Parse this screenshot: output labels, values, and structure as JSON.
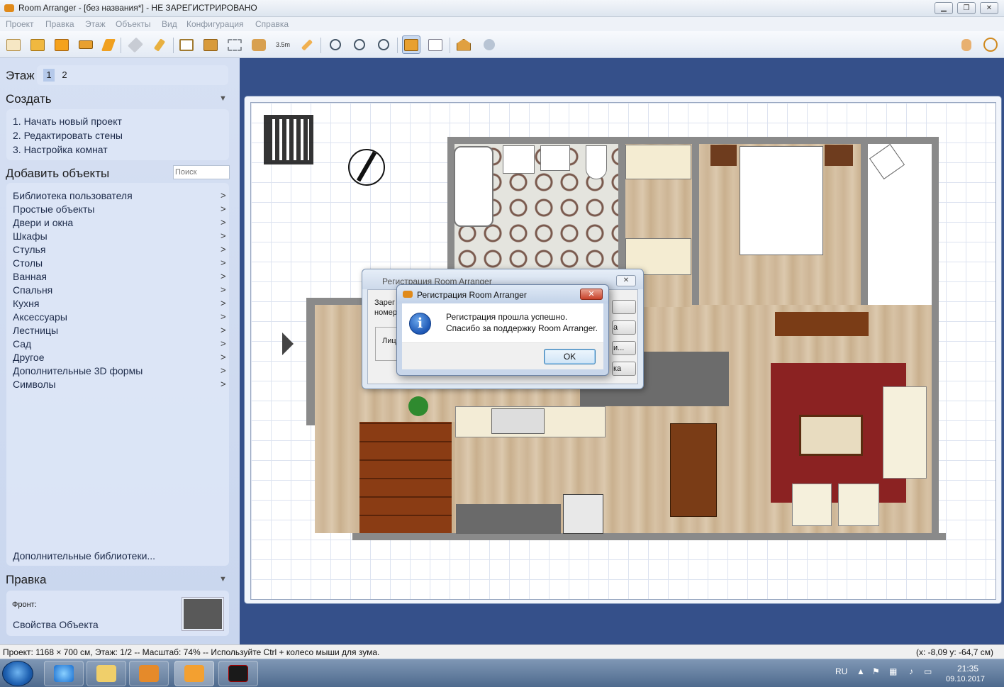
{
  "window": {
    "title": "Room Arranger - [без названия*] - НЕ ЗАРЕГИСТРИРОВАНО",
    "buttons": [
      "minimize-icon",
      "restore-icon",
      "close-icon"
    ]
  },
  "menu": [
    "Проект",
    "Правка",
    "Этаж",
    "Объекты",
    "Вид",
    "Конфигурация",
    "Справка"
  ],
  "toolbar": {
    "scale_label": "3.5m",
    "icons": [
      "new-icon",
      "open-icon",
      "save-icon",
      "print-icon",
      "select-icon",
      "pan-icon",
      "paint-icon",
      "room-icon",
      "wall-icon",
      "resize-icon",
      "object-icon",
      "measure-icon",
      "pencil-icon",
      "zoom-fit-icon",
      "zoom-in-icon",
      "zoom-out-icon",
      "view-2d-icon",
      "view-list-icon",
      "view-3d-icon",
      "settings-icon",
      "hand-icon",
      "info-icon"
    ]
  },
  "sidebar": {
    "floor_label": "Этаж",
    "floors": [
      "1",
      "2"
    ],
    "create_title": "Создать",
    "create_items": [
      "1. Начать новый проект",
      "2. Редактировать стены",
      "3. Настройка комнат"
    ],
    "add_title": "Добавить объекты",
    "search_placeholder": "Поиск",
    "library_items": [
      "Библиотека пользователя",
      "Простые объекты",
      "Двери и окна",
      "Шкафы",
      "Стулья",
      "Столы",
      "Ванная",
      "Спальня",
      "Кухня",
      "Аксессуары",
      "Лестницы",
      "Сад",
      "Другое",
      "Дополнительные 3D формы",
      "Символы"
    ],
    "more_libraries": "Дополнительные библиотеки...",
    "edit_title": "Правка",
    "front_label": "Фронт:",
    "properties_link": "Свойства Объекта",
    "swatch_color": "#595959"
  },
  "dialog_back": {
    "title": "Регистрация Room Arranger",
    "text_line1": "Зарег",
    "text_line2": "номер",
    "text_line3": "Лиц",
    "buttons": [
      "",
      "а",
      "и...",
      "ка"
    ]
  },
  "dialog_front": {
    "title": "Регистрация Room Arranger",
    "line1": "Регистрация прошла успешно.",
    "line2": "Спасибо за поддержку Room Arranger.",
    "ok": "OK",
    "close": "✕"
  },
  "status": {
    "left": "Проект: 1168 × 700 см, Этаж: 1/2 -- Масштаб: 74% -- Используйте Ctrl + колесо мыши для зума.",
    "right": "(x: -8,09 y: -64,7 см)"
  },
  "taskbar": {
    "apps": [
      "internet-explorer-icon",
      "explorer-icon",
      "media-player-icon",
      "room-arranger-icon",
      "game-icon"
    ],
    "lang": "RU",
    "time": "21:35",
    "date": "09.10.2017"
  },
  "colors": {
    "canvas_bg": "#35508a",
    "wall": "#8a8a8a",
    "rug": "#8b2222",
    "furniture_wood": "#7a3c16"
  }
}
